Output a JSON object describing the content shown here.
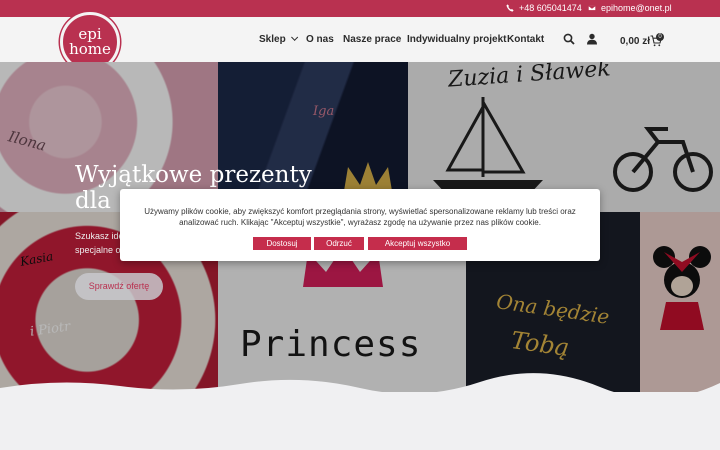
{
  "topbar": {
    "phone_icon": "phone-icon",
    "phone": "+48 605041474",
    "email_icon": "mail-icon",
    "email": "epihome@onet.pl"
  },
  "logo": {
    "line1": "epi",
    "line2": "home"
  },
  "nav": {
    "items": [
      {
        "label": "Sklep",
        "has_dropdown": true
      },
      {
        "label": "O nas"
      },
      {
        "label": "Nasze prace"
      },
      {
        "label": "Indywidualny projekt"
      },
      {
        "label": "Kontakt"
      }
    ]
  },
  "header_icons": {
    "search": "search-icon",
    "account": "user-icon",
    "cart": "cart-icon"
  },
  "cart": {
    "total": "0,00 zł",
    "count": "0"
  },
  "hero": {
    "title_line1": "Wyjątkowe prezenty",
    "title_line2": "dla",
    "subtitle_line1": "Szukasz ide",
    "subtitle_line2": "specjalne o",
    "cta": "Sprawdź ofertę",
    "tiles": {
      "t1": "Ilona",
      "t2": "Iga",
      "t3": "Zuzia i Sławek",
      "t4a": "Kasia",
      "t4b": "i Piotr",
      "t5": "Princess",
      "t6a": "Ona będzie",
      "t6b": "Tobą"
    }
  },
  "cookie": {
    "text_line1": "Używamy plików cookie, aby zwiększyć komfort przeglądania strony, wyświetlać spersonalizowane reklamy lub treści oraz",
    "text_line2": "analizować ruch. Klikając \"Akceptuj wszystkie\", wyrażasz zgodę na używanie przez nas plików cookie.",
    "customize": "Dostosuj",
    "reject": "Odrzuć",
    "accept_all": "Akceptuj wszystko"
  },
  "colors": {
    "brand": "#b93150",
    "button": "#c52d4c",
    "text": "#2b2b2b"
  }
}
